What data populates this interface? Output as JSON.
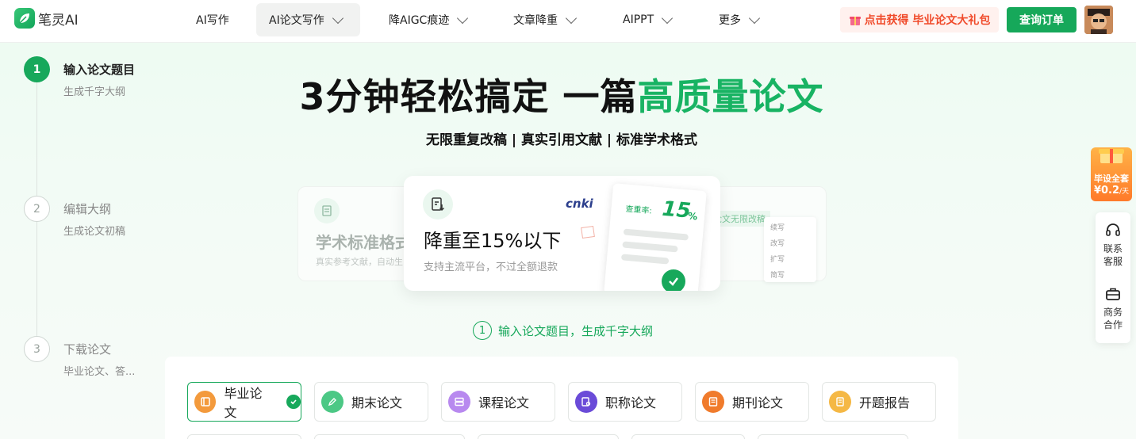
{
  "app": {
    "name": "笔灵AI"
  },
  "nav": [
    {
      "label": "AI写作",
      "has_dropdown": false,
      "active": false
    },
    {
      "label": "AI论文写作",
      "has_dropdown": true,
      "active": true
    },
    {
      "label": "降AIGC痕迹",
      "has_dropdown": true,
      "active": false
    },
    {
      "label": "文章降重",
      "has_dropdown": true,
      "active": false
    },
    {
      "label": "AIPPT",
      "has_dropdown": true,
      "active": false
    },
    {
      "label": "更多",
      "has_dropdown": true,
      "active": false
    }
  ],
  "header": {
    "gift_label": "点击获得 毕业论文大礼包",
    "order_label": "查询订单"
  },
  "steps": [
    {
      "num": "1",
      "title": "输入论文题目",
      "sub": "生成千字大纲",
      "active": true
    },
    {
      "num": "2",
      "title": "编辑大纲",
      "sub": "生成论文初稿",
      "active": false
    },
    {
      "num": "3",
      "title": "下载论文",
      "sub": "毕业论文、答...",
      "active": false
    }
  ],
  "hero": {
    "title_main": "3分钟轻松搞定 一篇",
    "title_accent": "高质量论文",
    "subtitle": "无限重复改稿 | 真实引用文献 | 标准学术格式"
  },
  "cards": {
    "left_title": "学术标准格式",
    "left_sub": "真实参考文献，自动生",
    "front_title": "降重至15%以下",
    "front_sub": "支持主流平台，不过全额退款",
    "front_brand": "cnki",
    "paper_label": "查重率:",
    "paper_value": "15",
    "paper_unit": "%",
    "right_tag": "论文无限改稿",
    "right_menu": [
      "续写",
      "改写",
      "扩写",
      "简写"
    ]
  },
  "progress": {
    "num": "1",
    "label": "输入论文题目，生成千字大纲"
  },
  "types": [
    {
      "label": "毕业论文",
      "color": "#f39a3c",
      "selected": true
    },
    {
      "label": "期末论文",
      "color": "#4cc885",
      "selected": false
    },
    {
      "label": "课程论文",
      "color": "#b889ef",
      "selected": false
    },
    {
      "label": "职称论文",
      "color": "#6a4bd8",
      "selected": false
    },
    {
      "label": "期刊论文",
      "color": "#f07b2c",
      "selected": false
    },
    {
      "label": "开题报告",
      "color": "#f5b845",
      "selected": false
    }
  ],
  "promo": {
    "line1": "毕设全套",
    "price": "¥0.2",
    "unit": "/天"
  },
  "side": [
    {
      "label": "联系客服",
      "icon": "headset-icon"
    },
    {
      "label": "商务合作",
      "icon": "briefcase-icon"
    }
  ]
}
